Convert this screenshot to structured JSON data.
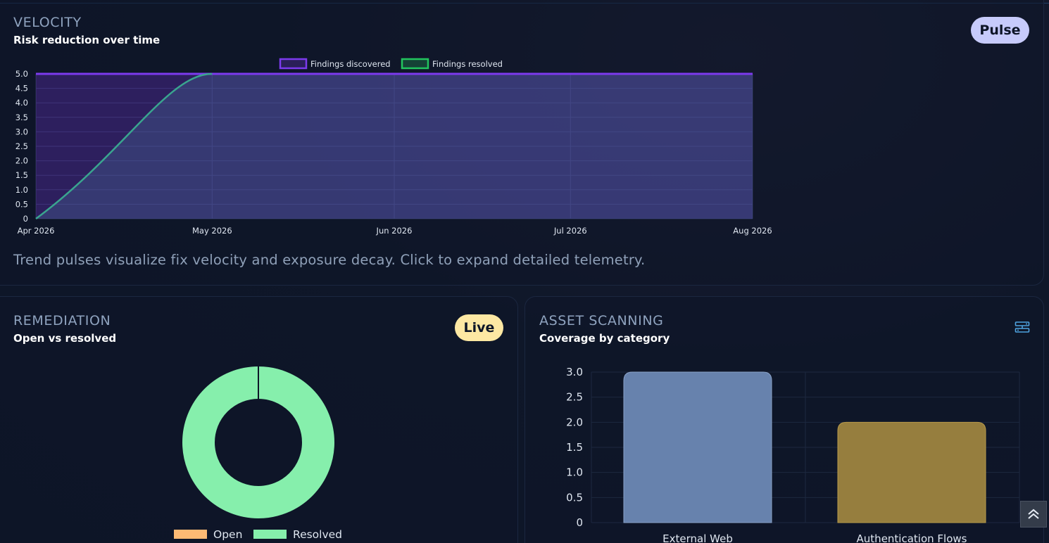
{
  "velocity": {
    "eyebrow": "VELOCITY",
    "subtitle": "Risk reduction over time",
    "badge": "Pulse",
    "description": "Trend pulses visualize fix velocity and exposure decay. Click to expand detailed telemetry.",
    "colors": {
      "discovered": "#7c3aed",
      "resolved": "#22c55e",
      "resolved_line": "#3aa58f"
    }
  },
  "remediation": {
    "eyebrow": "REMEDIATION",
    "subtitle": "Open vs resolved",
    "badge": "Live",
    "colors": {
      "open": "#fdba74",
      "resolved": "#86efac"
    }
  },
  "asset_scanning": {
    "eyebrow": "ASSET SCANNING",
    "subtitle": "Coverage by category",
    "settings_icon": "settings-sliders-icon",
    "colors": {
      "external_web": "#6782ad",
      "authentication_flows": "#967e3e"
    }
  },
  "scroll_top_icon": "double-chevron-up-icon",
  "chart_data": [
    {
      "type": "area",
      "x_ticks": [
        "Apr 2026",
        "May 2026",
        "Jun 2026",
        "Jul 2026",
        "Aug 2026"
      ],
      "y_ticks": [
        "0",
        "0.5",
        "1.0",
        "1.5",
        "2.0",
        "2.5",
        "3.0",
        "3.5",
        "4.0",
        "4.5",
        "5.0"
      ],
      "ylim": [
        0,
        5
      ],
      "grid": true,
      "legend_position": "top-center",
      "series": [
        {
          "name": "Findings discovered",
          "x": [
            "2026-04-01",
            "2026-08-01"
          ],
          "values": [
            5,
            5
          ]
        },
        {
          "name": "Findings resolved",
          "x": [
            "2026-04-01",
            "2026-05-01",
            "2026-08-01"
          ],
          "values": [
            0,
            5,
            5
          ]
        }
      ]
    },
    {
      "type": "pie",
      "labels": [
        "Open",
        "Resolved"
      ],
      "values": [
        0,
        1
      ],
      "legend_position": "bottom"
    },
    {
      "type": "bar",
      "categories": [
        "External Web",
        "Authentication Flows"
      ],
      "values": [
        3,
        2
      ],
      "ylim": [
        0,
        3
      ],
      "y_ticks": [
        "0",
        "0.5",
        "1.0",
        "1.5",
        "2.0",
        "2.5",
        "3.0"
      ],
      "grid": true
    }
  ]
}
